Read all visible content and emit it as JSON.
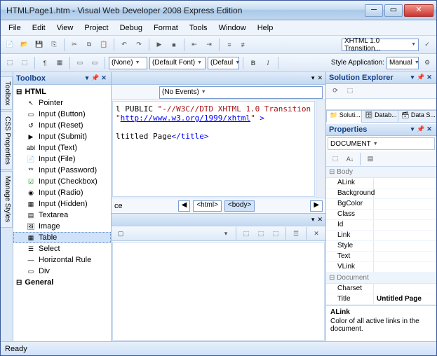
{
  "window": {
    "title": "HTMLPage1.htm - Visual Web Developer 2008 Express Edition"
  },
  "menu": [
    "File",
    "Edit",
    "View",
    "Project",
    "Debug",
    "Format",
    "Tools",
    "Window",
    "Help"
  ],
  "toolbar1": {
    "doctype_combo": "XHTML 1.0 Transition..."
  },
  "toolbar2": {
    "combo_style": "(None)",
    "combo_font": "(Default Font)",
    "combo_size": "(Defaul",
    "bold": "B",
    "italic": "I",
    "style_app_label": "Style Application:",
    "style_app_value": "Manual"
  },
  "side_tabs": [
    "Toolbox",
    "CSS Properties",
    "Manage Styles"
  ],
  "toolbox": {
    "title": "Toolbox",
    "sections": [
      {
        "name": "HTML",
        "items": [
          "Pointer",
          "Input (Button)",
          "Input (Reset)",
          "Input (Submit)",
          "Input (Text)",
          "Input (File)",
          "Input (Password)",
          "Input (Checkbox)",
          "Input (Radio)",
          "Input (Hidden)",
          "Textarea",
          "Image",
          "Table",
          "Select",
          "Horizontal Rule",
          "Div"
        ],
        "selected": "Table"
      },
      {
        "name": "General",
        "items": []
      }
    ]
  },
  "editor": {
    "events_combo": "(No Events)",
    "line1a": "l PUBLIC ",
    "line1b": "\"-//W3C//DTD XHTML 1.0 Transition",
    "line2a": "\"",
    "line2b": "http://www.w3.org/1999/xhtml",
    "line2c": "\"",
    "line2d": " >",
    "line4a": "ltitled Page",
    "line4b": "</title>",
    "breadcrumb_prefix": "ce",
    "bc": [
      "<html>",
      "<body>"
    ]
  },
  "soln": {
    "title": "Solution Explorer",
    "tabs": [
      "Soluti...",
      "Datab...",
      "Data S..."
    ]
  },
  "props": {
    "title": "Properties",
    "target": "DOCUMENT",
    "cats": [
      {
        "name": "Body",
        "rows": [
          {
            "n": "ALink",
            "v": ""
          },
          {
            "n": "Background",
            "v": ""
          },
          {
            "n": "BgColor",
            "v": ""
          },
          {
            "n": "Class",
            "v": ""
          },
          {
            "n": "Id",
            "v": ""
          },
          {
            "n": "Link",
            "v": ""
          },
          {
            "n": "Style",
            "v": ""
          },
          {
            "n": "Text",
            "v": ""
          },
          {
            "n": "VLink",
            "v": ""
          }
        ]
      },
      {
        "name": "Document",
        "rows": [
          {
            "n": "Charset",
            "v": ""
          },
          {
            "n": "Title",
            "v": "Untitled Page"
          }
        ]
      }
    ],
    "help_title": "ALink",
    "help_text": "Color of all active links in the document."
  },
  "status": "Ready"
}
